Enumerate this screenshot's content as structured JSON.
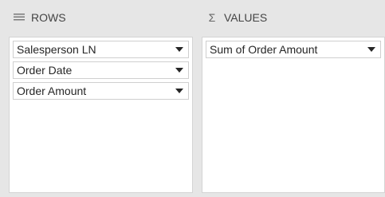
{
  "rows_panel": {
    "title": "ROWS",
    "icon": "rows-icon",
    "fields": [
      {
        "label": "Salesperson LN"
      },
      {
        "label": "Order Date"
      },
      {
        "label": "Order Amount"
      }
    ]
  },
  "values_panel": {
    "title": "VALUES",
    "icon": "sigma-icon",
    "symbol": "Σ",
    "fields": [
      {
        "label": "Sum of Order Amount"
      }
    ]
  }
}
